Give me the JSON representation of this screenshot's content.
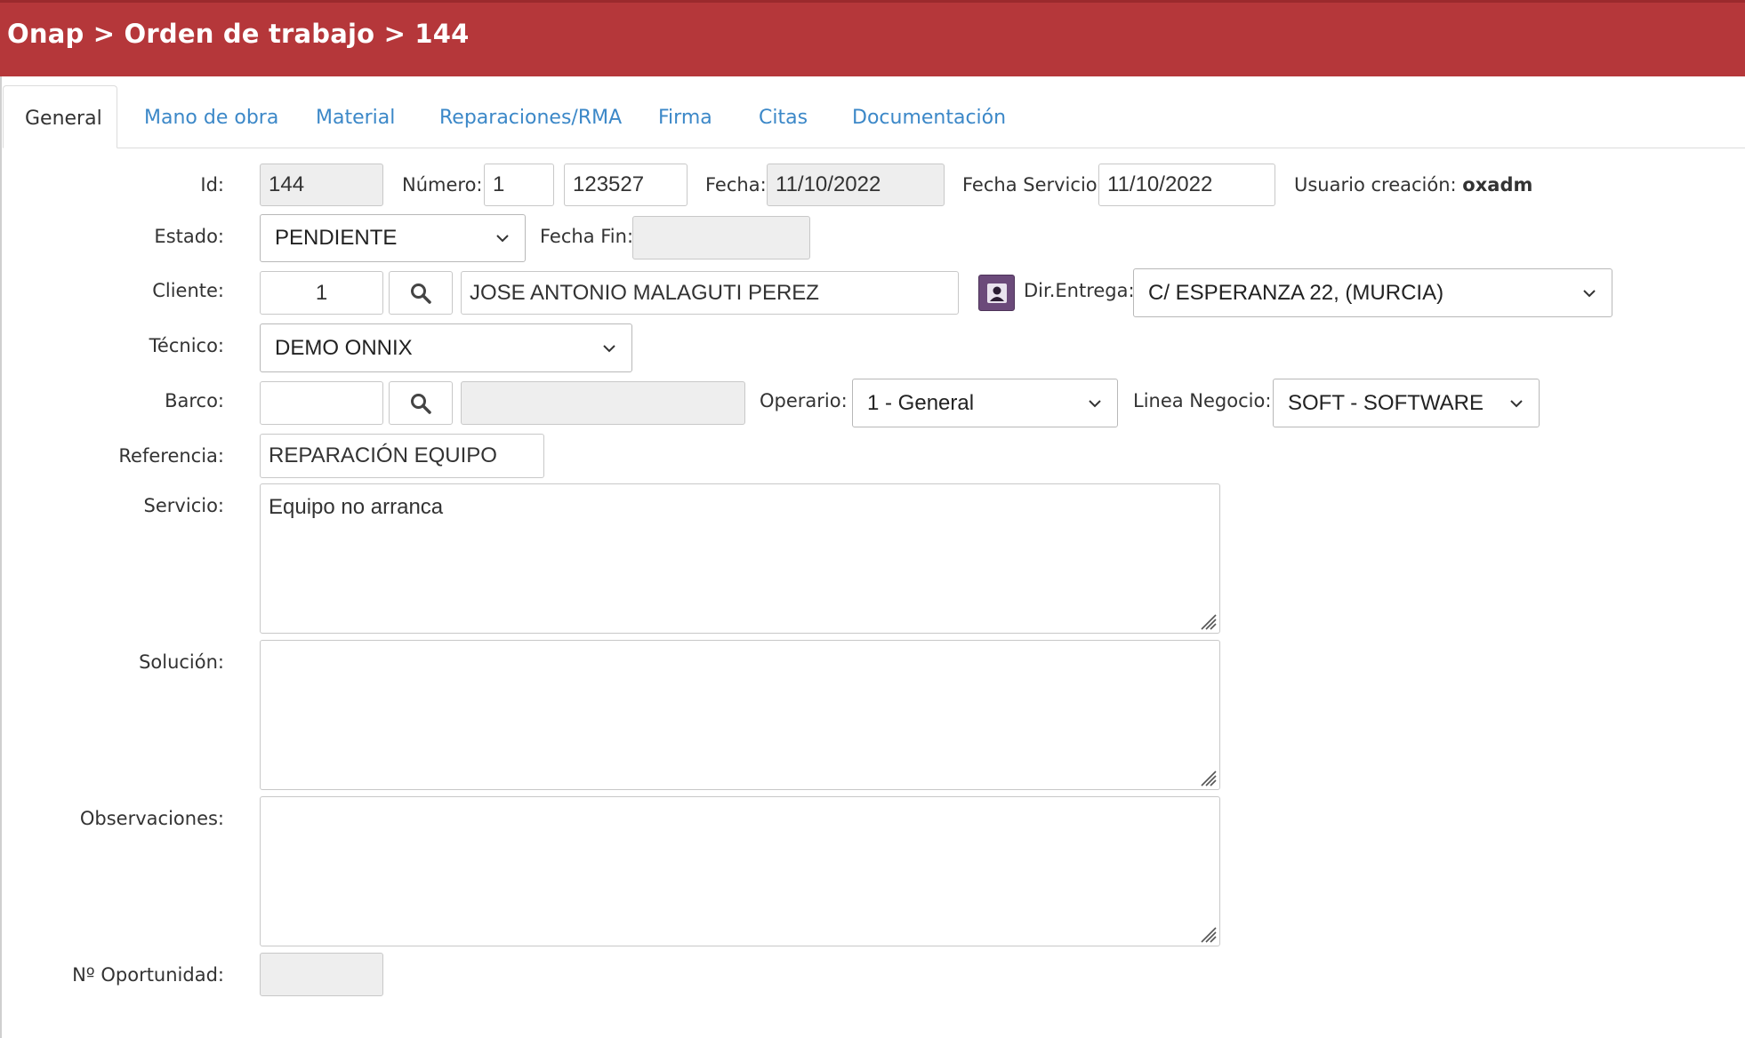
{
  "header": {
    "breadcrumb": "Onap > Orden de trabajo > 144"
  },
  "tabs": [
    {
      "label": "General",
      "active": true
    },
    {
      "label": "Mano de obra"
    },
    {
      "label": "Material"
    },
    {
      "label": "Reparaciones/RMA"
    },
    {
      "label": "Firma"
    },
    {
      "label": "Citas"
    },
    {
      "label": "Documentación"
    }
  ],
  "form": {
    "id": {
      "label": "Id:",
      "value": "144"
    },
    "numero": {
      "label": "Número:",
      "serie": "1",
      "value": "123527"
    },
    "fecha": {
      "label": "Fecha:",
      "value": "11/10/2022"
    },
    "fecha_servicio": {
      "label": "Fecha Servicio:",
      "value": "11/10/2022"
    },
    "usuario": {
      "label": "Usuario creación:",
      "value": "oxadm"
    },
    "estado": {
      "label": "Estado:",
      "value": "PENDIENTE"
    },
    "fecha_fin": {
      "label": "Fecha Fin:",
      "value": ""
    },
    "cliente": {
      "label": "Cliente:",
      "code": "1",
      "name": "JOSE ANTONIO MALAGUTI PEREZ"
    },
    "dir_entrega": {
      "label": "Dir.Entrega:",
      "value": "C/ ESPERANZA 22, (MURCIA)"
    },
    "tecnico": {
      "label": "Técnico:",
      "value": "DEMO ONNIX"
    },
    "barco": {
      "label": "Barco:",
      "code": "",
      "name": ""
    },
    "operario": {
      "label": "Operario:",
      "value": "1 - General"
    },
    "linea_negocio": {
      "label": "Linea Negocio:",
      "value": "SOFT - SOFTWARE"
    },
    "referencia": {
      "label": "Referencia:",
      "value": "REPARACIÓN EQUIPO"
    },
    "servicio": {
      "label": "Servicio:",
      "value": "Equipo no arranca"
    },
    "solucion": {
      "label": "Solución:",
      "value": ""
    },
    "observaciones": {
      "label": "Observaciones:",
      "value": ""
    },
    "oportunidad": {
      "label": "Nº Oportunidad:",
      "value": ""
    }
  },
  "colors": {
    "header_bg": "#b5373a",
    "tab_link": "#3c88c8",
    "readonly_bg": "#eeeeee"
  },
  "icons": {
    "search": "search-icon",
    "contact": "contact-card-icon",
    "dropdown": "chevron-down-icon",
    "resize": "resize-grip-icon"
  }
}
